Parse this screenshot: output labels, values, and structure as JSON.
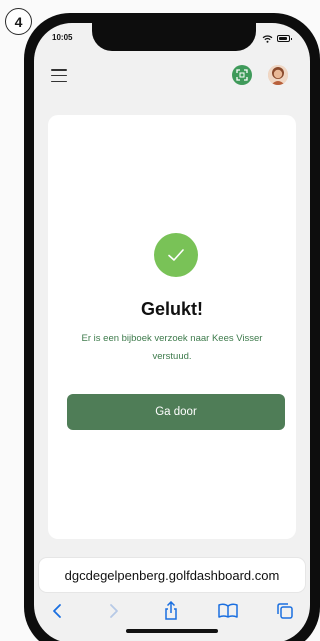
{
  "step": "4",
  "status_bar": {
    "time": "10:05"
  },
  "header": {
    "menu_icon": "hamburger-menu-icon",
    "scan_icon": "qr-scan-icon",
    "avatar_icon": "user-avatar"
  },
  "card": {
    "icon": "checkmark-icon",
    "title": "Gelukt!",
    "message": "Er is een bijboek verzoek naar Kees Visser verstuud.",
    "button_label": "Ga door"
  },
  "browser": {
    "url": "dgcdegelpenberg.golfdashboard.com",
    "toolbar": [
      "back-icon",
      "forward-icon",
      "share-icon",
      "bookmarks-icon",
      "tabs-icon"
    ]
  },
  "colors": {
    "accent_green": "#4f7d57",
    "success_green": "#79c257",
    "message_green": "#3d7a4b",
    "scan_green": "#3f9a5a"
  }
}
